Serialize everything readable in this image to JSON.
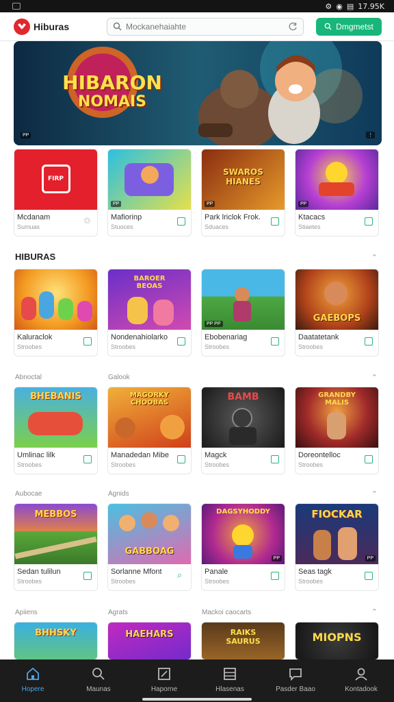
{
  "status_bar": {
    "time": "17.95K"
  },
  "header": {
    "app_name": "Hiburas",
    "search_placeholder": "Mockanehaiahte",
    "login_label": "Dmgmetst"
  },
  "banner": {
    "title_line1": "HIBARON",
    "title_line2": "NOMAIS",
    "badge": "PP"
  },
  "top_row": [
    {
      "title": "Mcdanam",
      "sub": "Sumuas",
      "thumb_text": "FIRP",
      "icon": "pin-icon"
    },
    {
      "title": "Mafiorinp",
      "sub": "Stuoces",
      "thumb_text": "",
      "icon": "bookmark-icon"
    },
    {
      "title": "Park lriclok Frok.",
      "sub": "Sduaces",
      "thumb_text": "SWAROS HIANES",
      "icon": "bookmark-icon"
    },
    {
      "title": "Ktacacs",
      "sub": "Stiaetes",
      "thumb_text": "",
      "icon": "bookmark-icon"
    }
  ],
  "section": {
    "title": "HIBURAS"
  },
  "grid_rows": [
    {
      "labels": [
        "",
        ""
      ],
      "cards": [
        {
          "title": "Kaluraclok",
          "sub": "Stroobes",
          "thumb_text": ""
        },
        {
          "title": "Nondenahiolarko",
          "sub": "Stroobes",
          "thumb_text": "BAROER BEOAS"
        },
        {
          "title": "Ebobenariag",
          "sub": "Stroobes",
          "thumb_text": ""
        },
        {
          "title": "Daatatetank",
          "sub": "Stroobes",
          "thumb_text": "GAEBOPS"
        }
      ]
    },
    {
      "labels": [
        "Abnoctal",
        "Galook"
      ],
      "cards": [
        {
          "title": "Umlinac lilk",
          "sub": "Stroobes",
          "thumb_text": "BHEBANIS"
        },
        {
          "title": "Manadedan Mibe",
          "sub": "Stroobes",
          "thumb_text": "MAGORKY CHOOBAS"
        },
        {
          "title": "Magck",
          "sub": "Stroobes",
          "thumb_text": "BAMB"
        },
        {
          "title": "Doreontelloc",
          "sub": "Stroobes",
          "thumb_text": "GRANDBY MALIS"
        }
      ]
    },
    {
      "labels": [
        "Aubocae",
        "Agnids"
      ],
      "cards": [
        {
          "title": "Sedan tulilun",
          "sub": "Stroobes",
          "thumb_text": "MEBBOS"
        },
        {
          "title": "Sorlanne Mfont",
          "sub": "Stroobes",
          "thumb_text": "GABBOAG"
        },
        {
          "title": "Panale",
          "sub": "Stroobes",
          "thumb_text": "DAGSYHODDY"
        },
        {
          "title": "Seas tagk",
          "sub": "Stroobes",
          "thumb_text": "FIOCKAR"
        }
      ]
    },
    {
      "labels": [
        "Apiiens",
        "Agrats",
        "Mackoi caocarts"
      ],
      "cards": [
        {
          "title": "",
          "sub": "",
          "thumb_text": "BHHSKY"
        },
        {
          "title": "",
          "sub": "",
          "thumb_text": "HAEHARS"
        },
        {
          "title": "",
          "sub": "",
          "thumb_text": "RAIKS SAURUS"
        },
        {
          "title": "",
          "sub": "",
          "thumb_text": "MIOPNS"
        }
      ]
    }
  ],
  "bottom_nav": [
    {
      "label": "Hopere",
      "icon": "home-icon"
    },
    {
      "label": "Maunas",
      "icon": "search-icon"
    },
    {
      "label": "Haporne",
      "icon": "edit-icon"
    },
    {
      "label": "Hlasenas",
      "icon": "list-icon"
    },
    {
      "label": "Pasder Baao",
      "icon": "chat-icon"
    },
    {
      "label": "Kontadook",
      "icon": "profile-icon"
    }
  ]
}
